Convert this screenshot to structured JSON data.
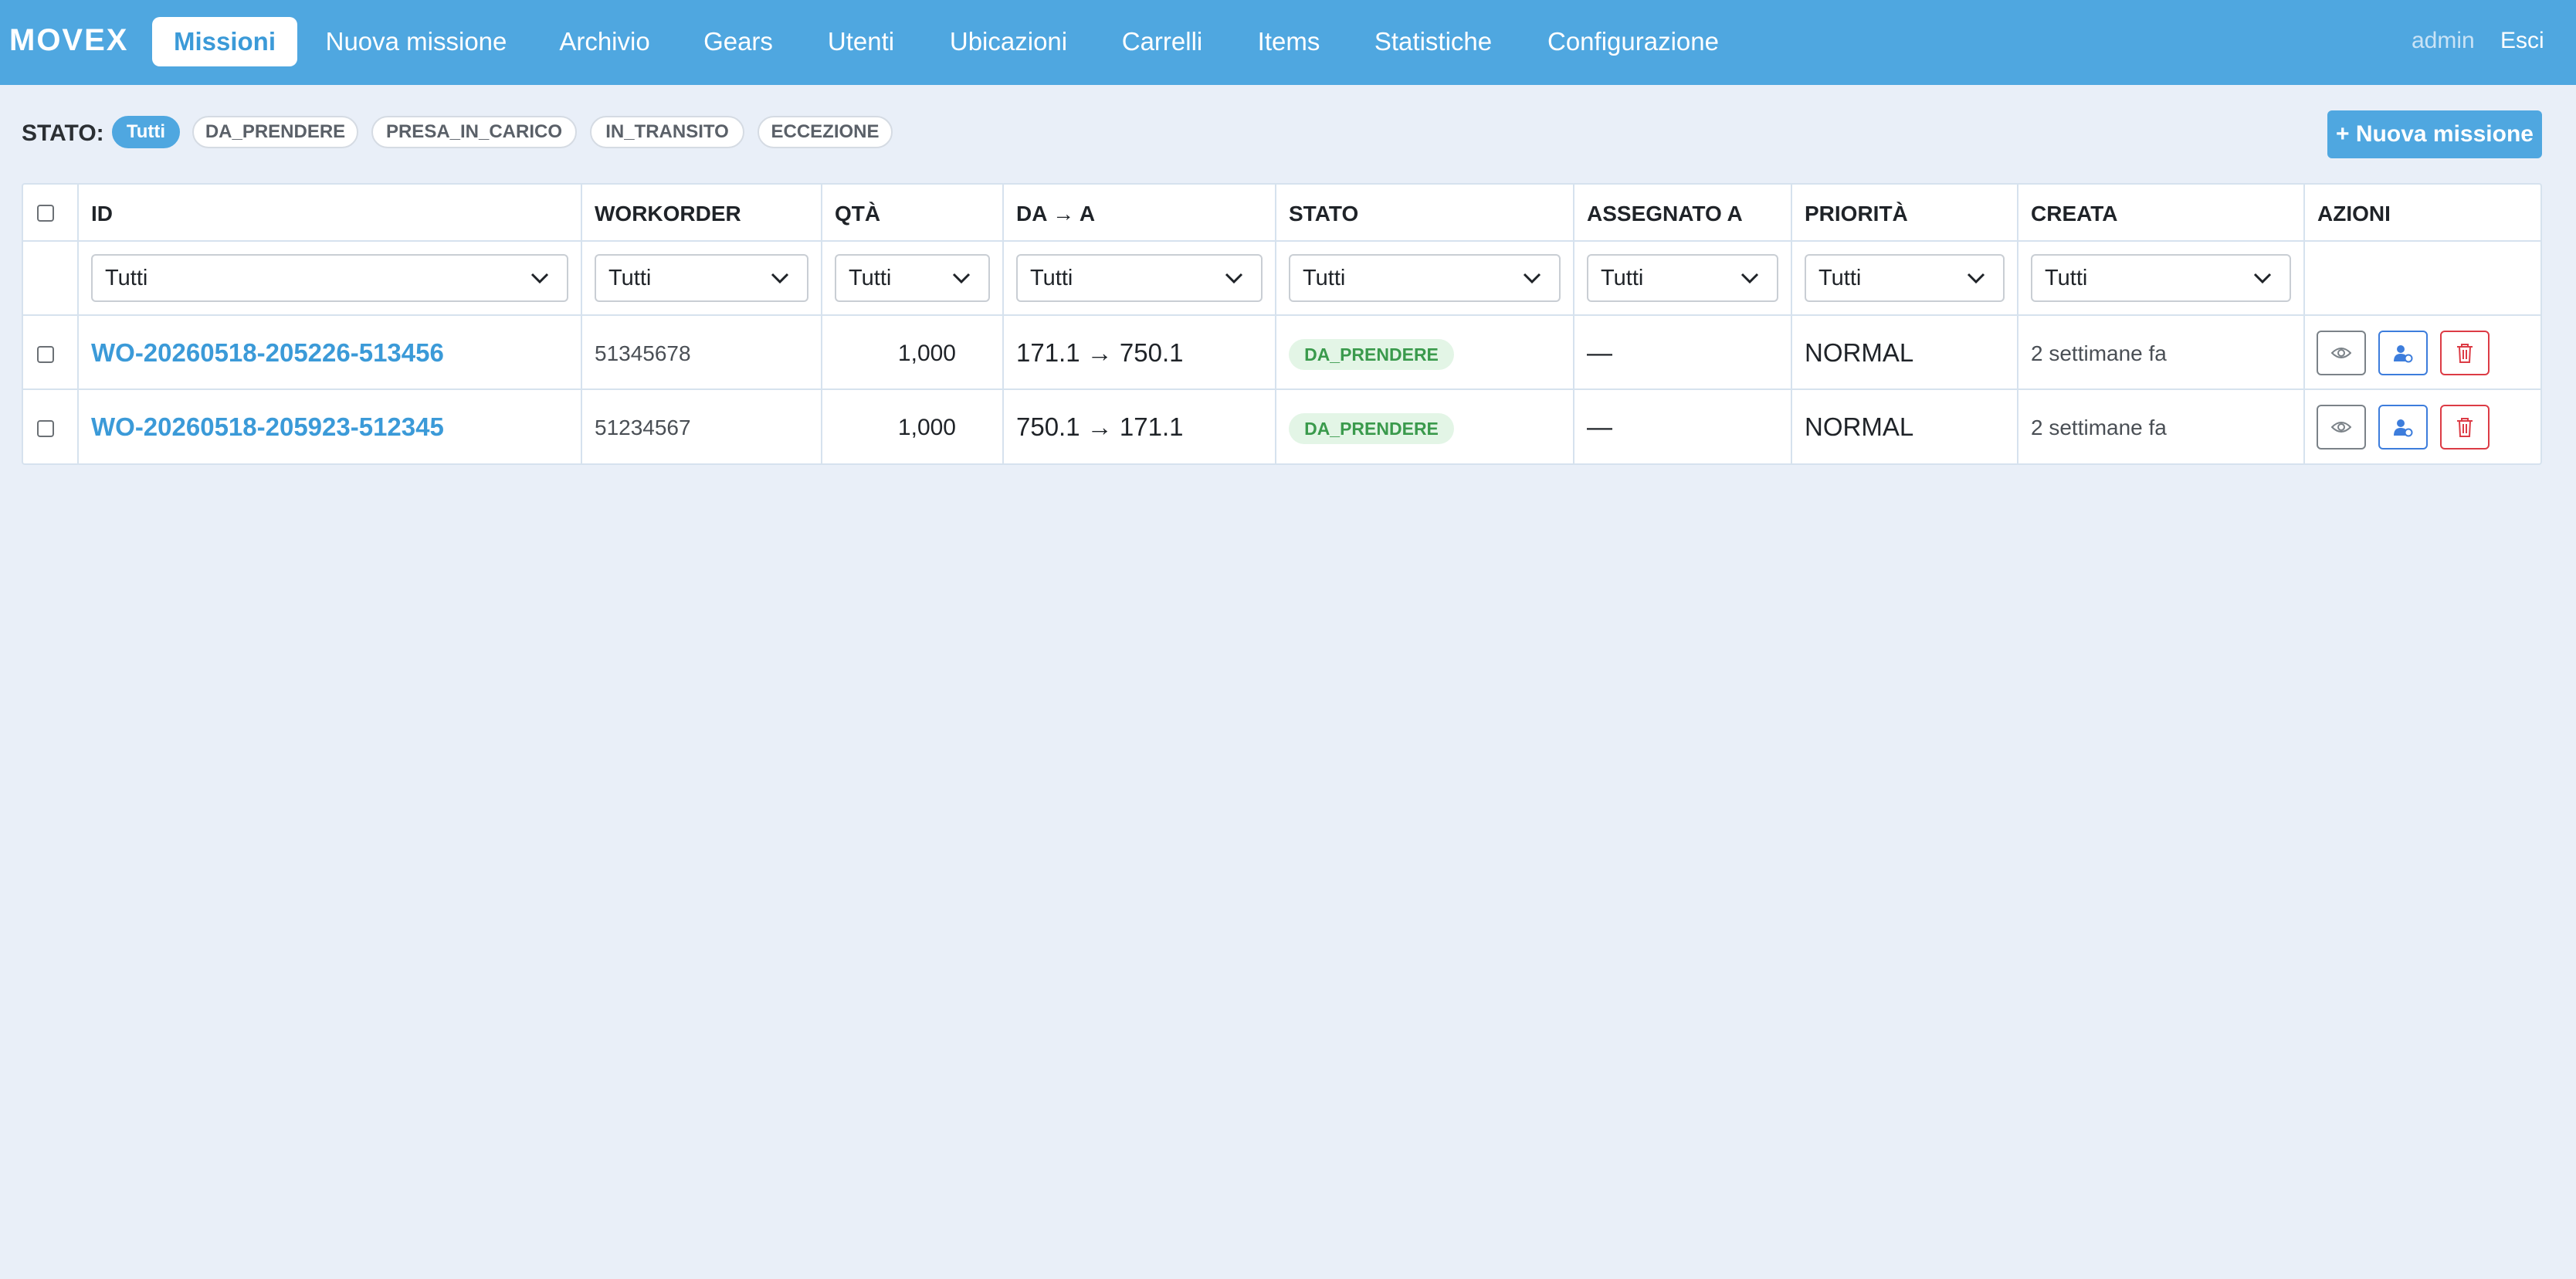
{
  "app": {
    "brand": "MOVEX"
  },
  "nav": {
    "items": [
      "Missioni",
      "Nuova missione",
      "Archivio",
      "Gears",
      "Utenti",
      "Ubicazioni",
      "Carrelli",
      "Items",
      "Statistiche",
      "Configurazione"
    ],
    "active": "Missioni",
    "user": "admin",
    "logout": "Esci"
  },
  "filter": {
    "label": "STATO:",
    "pills": [
      "Tutti",
      "DA_PRENDERE",
      "PRESA_IN_CARICO",
      "IN_TRANSITO",
      "ECCEZIONE"
    ],
    "active": "Tutti"
  },
  "actions": {
    "new_mission": "+ Nuova missione"
  },
  "table": {
    "columns": [
      "ID",
      "WORKORDER",
      "QTÀ",
      "DA → A",
      "STATO",
      "ASSEGNATO A",
      "PRIORITÀ",
      "CREATA",
      "AZIONI"
    ],
    "column_filters": [
      "Tutti",
      "Tutti",
      "Tutti",
      "Tutti",
      "Tutti",
      "Tutti",
      "Tutti",
      "Tutti"
    ],
    "rows": [
      {
        "id": "WO-20260518-205226-513456",
        "workorder": "51345678",
        "qty": "1,000",
        "route": "171.1 → 750.1",
        "status": "DA_PRENDERE",
        "assigned": "—",
        "priority": "NORMAL",
        "created": "2 settimane fa"
      },
      {
        "id": "WO-20260518-205923-512345",
        "workorder": "51234567",
        "qty": "1,000",
        "route": "750.1 → 171.1",
        "status": "DA_PRENDERE",
        "assigned": "—",
        "priority": "NORMAL",
        "created": "2 settimane fa"
      }
    ]
  },
  "icons": {
    "view": "eye-icon",
    "assign": "user-assign-icon",
    "delete": "trash-icon",
    "dropdown": "chevron-down-icon"
  },
  "colors": {
    "navbar": "#4fa7e0",
    "page_background": "#e9eff8",
    "link": "#3b9ad8",
    "status_badge_bg": "#e3f5e6",
    "status_badge_text": "#3a9a4c",
    "assign_button": "#3d7ddc",
    "delete_button": "#dc3b45"
  }
}
